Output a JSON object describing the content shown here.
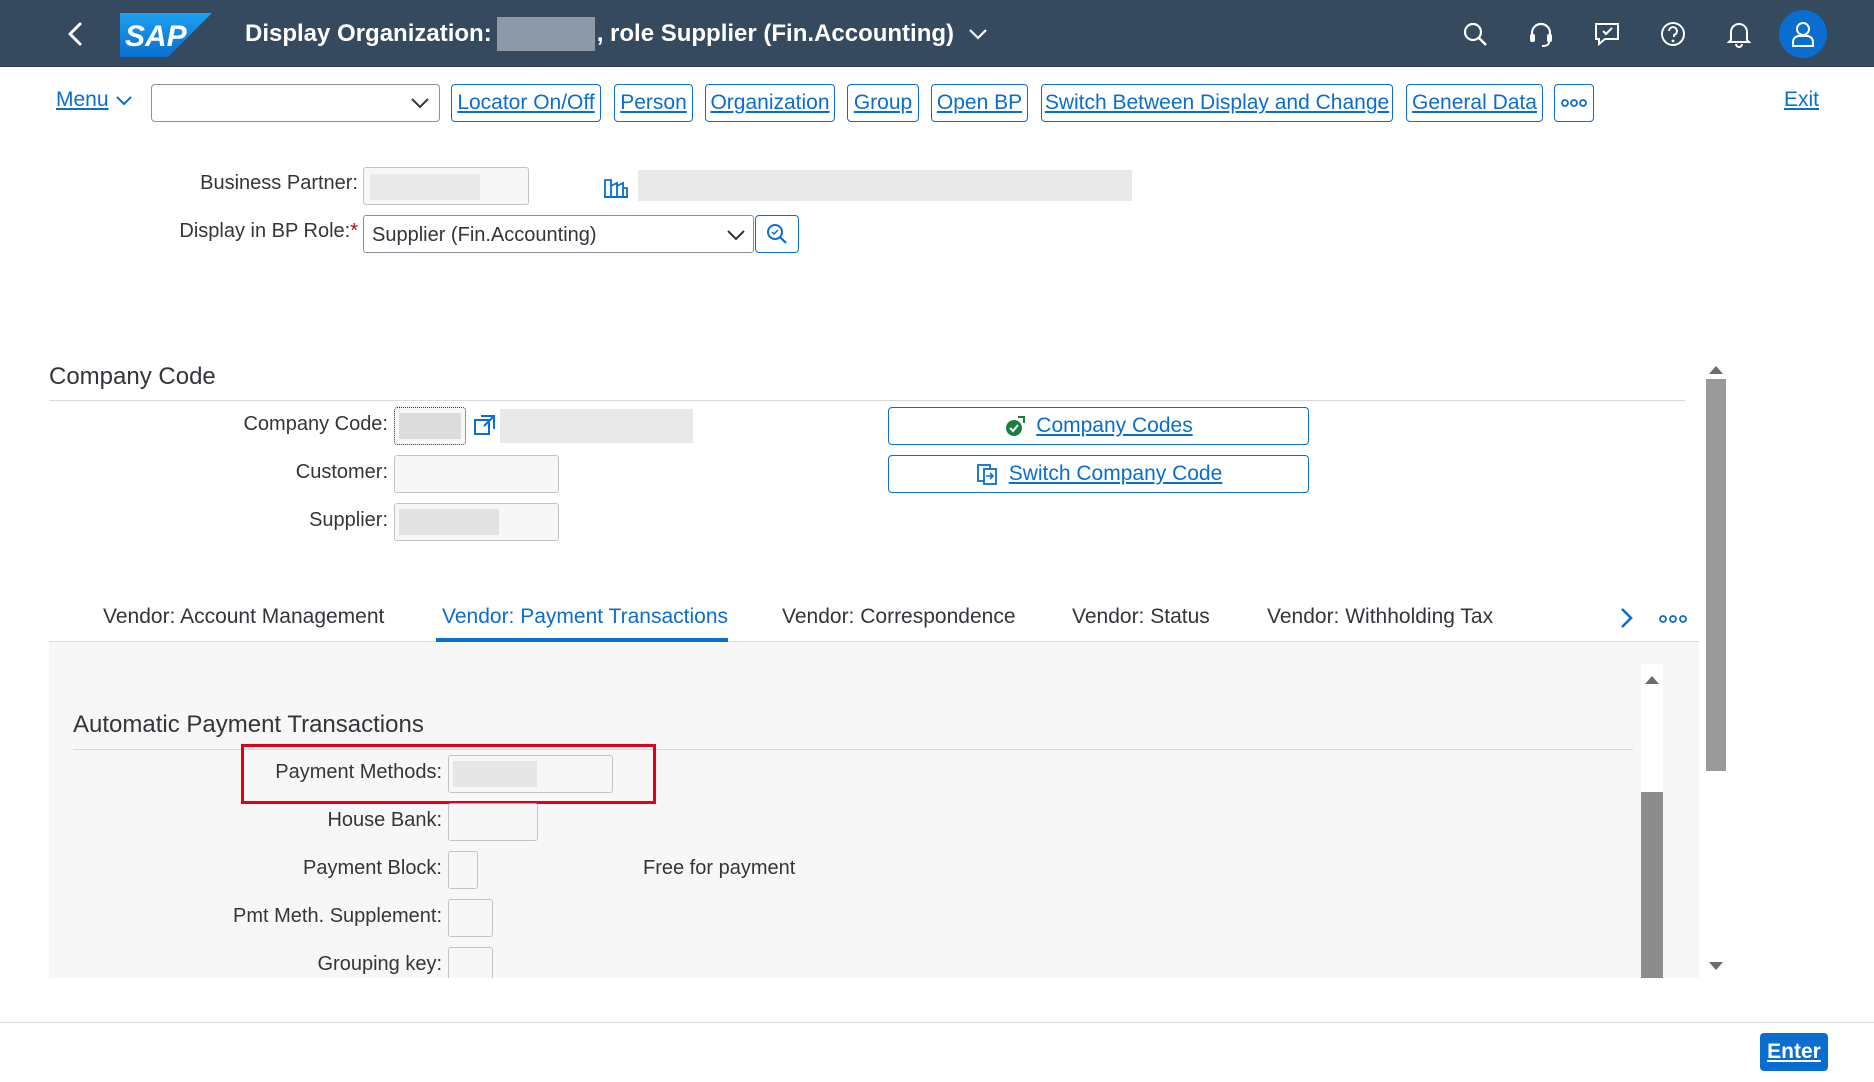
{
  "shell": {
    "title_prefix": "Display Organization:",
    "title_suffix": ", role Supplier (Fin.Accounting)",
    "logo_text": "SAP",
    "icons": [
      "back-icon",
      "search-icon",
      "headset-icon",
      "feedback-icon",
      "help-icon",
      "notification-bell-icon",
      "user-icon"
    ]
  },
  "toolbar": {
    "menu": "Menu",
    "combo_value": "",
    "buttons": [
      "Locator On/Off",
      "Person",
      "Organization",
      "Group",
      "Open BP",
      "Switch Between Display and Change",
      "General Data"
    ],
    "more": "more-icon",
    "exit": "Exit"
  },
  "header": {
    "bp_label": "Business Partner:",
    "bp_value": "",
    "role_label": "Display in BP Role:",
    "role_required": "*",
    "role_value": "Supplier (Fin.Accounting)"
  },
  "company_code_section": {
    "title": "Company Code",
    "company_code_label": "Company Code:",
    "customer_label": "Customer:",
    "supplier_label": "Supplier:",
    "btn_company_codes": "Company Codes",
    "btn_switch": "Switch Company Code"
  },
  "tabs": [
    {
      "label": "Vendor: Account Management",
      "active": false
    },
    {
      "label": "Vendor: Payment Transactions",
      "active": true
    },
    {
      "label": "Vendor: Correspondence",
      "active": false
    },
    {
      "label": "Vendor: Status",
      "active": false
    },
    {
      "label": "Vendor: Withholding Tax",
      "active": false
    }
  ],
  "payment_section": {
    "title": "Automatic Payment Transactions",
    "payment_methods_label": "Payment Methods:",
    "house_bank_label": "House Bank:",
    "payment_block_label": "Payment Block:",
    "payment_block_text": "Free for payment",
    "pmt_supplement_label": "Pmt Meth. Supplement:",
    "grouping_key_label": "Grouping key:"
  },
  "footer": {
    "enter": "Enter"
  },
  "colors": {
    "shell_bg": "#354a5f",
    "accent": "#0a6ed1",
    "highlight": "#e0001b"
  }
}
